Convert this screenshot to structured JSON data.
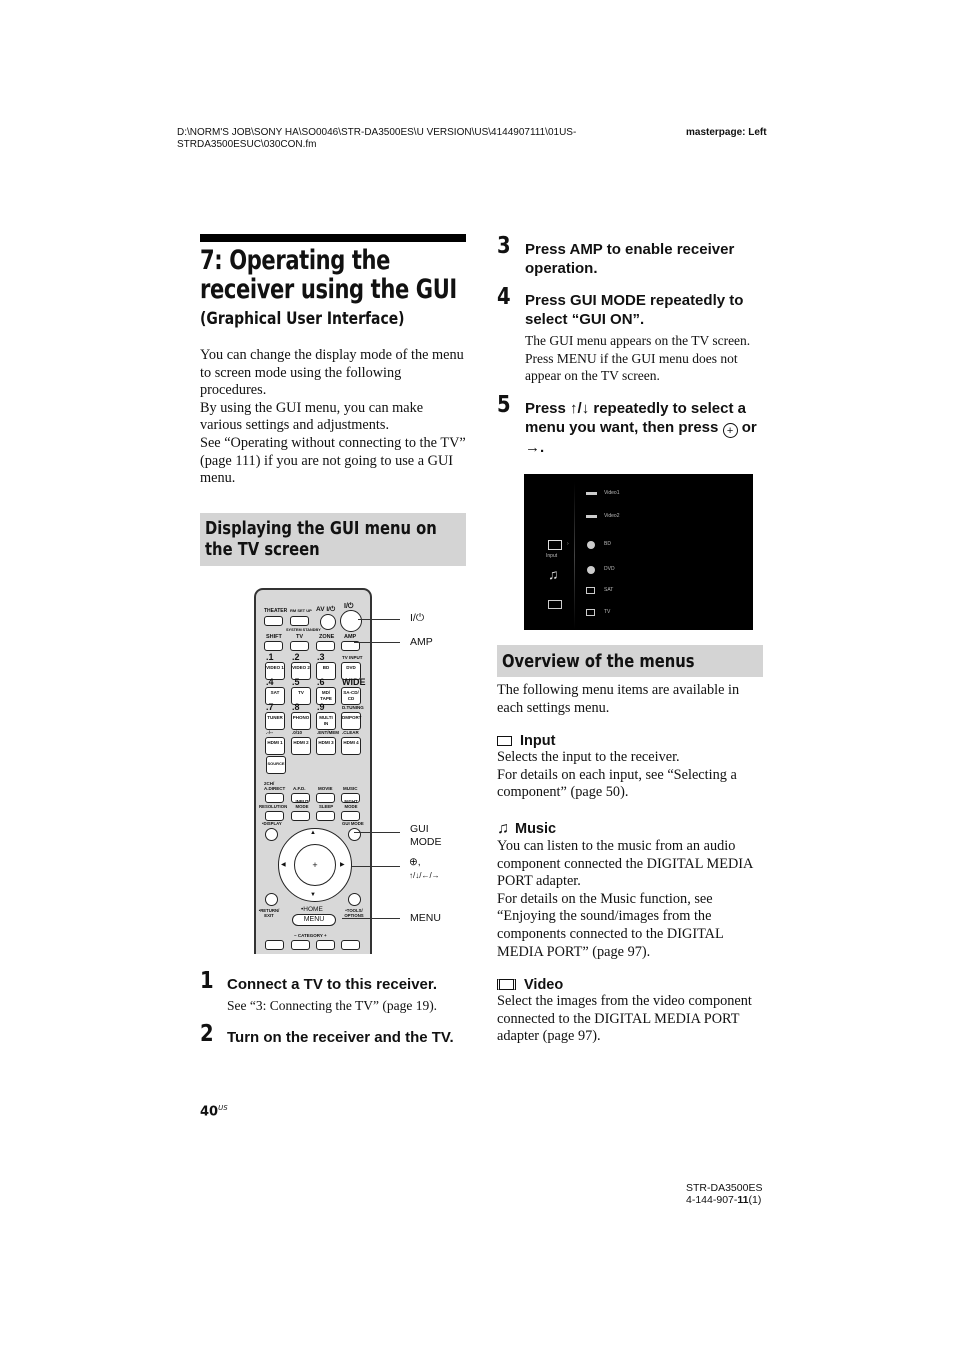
{
  "header": {
    "path_line1": "D:\\NORM'S JOB\\SONY HA\\SO0046\\STR-DA3500ES\\U VERSION\\US\\4144907111\\01US-",
    "path_line2": "STRDA3500ESUC\\030CON.fm",
    "masterpage": "masterpage: Left"
  },
  "title": {
    "main": "7: Operating the receiver using the GUI",
    "subtitle": "(Graphical User Interface)"
  },
  "intro": {
    "p1": "You can change the display mode of the menu to screen mode using the following procedures.",
    "p2": "By using the GUI menu, you can make various settings and adjustments.",
    "p3": "See “Operating without connecting to the TV” (page 111) if you are not going to use a GUI menu."
  },
  "section1": {
    "title": "Displaying the GUI menu on the TV screen"
  },
  "remote": {
    "top_labels": [
      "THEATER",
      "RM SET UP",
      "AV I/⏻",
      "I/⏻"
    ],
    "system_standby": "SYSTEM STANDBY",
    "row2_labels": [
      "SHIFT",
      "TV",
      "ZONE",
      "AMP"
    ],
    "numpad": [
      {
        "num": ".1",
        "key": "VIDEO 1"
      },
      {
        "num": ".2",
        "key": "VIDEO 2"
      },
      {
        "num": ".3",
        "key": "BD"
      },
      {
        "num": "TV INPUT",
        "key": "DVD"
      },
      {
        "num": ".4",
        "key": "SAT"
      },
      {
        "num": ".5",
        "key": "TV"
      },
      {
        "num": ".6",
        "key": "MD/ TAPE"
      },
      {
        "num": "WIDE",
        "key": "SA-CD/ CD"
      },
      {
        "num": ".7",
        "key": "TUNER"
      },
      {
        "num": ".8",
        "key": "PHONO"
      },
      {
        "num": ".9",
        "key": "MULTI IN"
      },
      {
        "num": "D.TUNING",
        "key": "DMPORT"
      },
      {
        "num": ".-/--",
        "key": "HDMI 1"
      },
      {
        "num": ".0/10",
        "key": "HDMI 2"
      },
      {
        "num": ".ENT/MEM",
        "key": "HDMI 3"
      },
      {
        "num": ".CLEAR",
        "key": "HDMI 4"
      }
    ],
    "source": "SOURCE",
    "mode_row1": [
      "2CH/ A.DIRECT",
      "A.F.D.",
      "MOVIE",
      "MUSIC"
    ],
    "mode_row2": [
      "RESOLUTION",
      "INPUT MODE",
      "SLEEP",
      "NIGHT MODE"
    ],
    "display": "•DISPLAY",
    "gui_mode": "GUI MODE",
    "return_exit": "•RETURN/ EXIT",
    "home": "•HOME",
    "menu": "MENU",
    "tools_options": "•TOOLS/ OPTIONS",
    "category": "−  CATEGORY  +"
  },
  "callouts": {
    "power": "I/⏻",
    "amp": "AMP",
    "gui_mode": "GUI MODE",
    "enter_arrows_line1": "⊕,",
    "enter_arrows_line2": "↑/↓/←/→",
    "menu": "MENU"
  },
  "steps": [
    {
      "num": "1",
      "text": "Connect a TV to this receiver.",
      "sub": "See “3: Connecting the TV” (page 19)."
    },
    {
      "num": "2",
      "text": "Turn on the receiver and the TV.",
      "sub": ""
    },
    {
      "num": "3",
      "text": "Press AMP to enable receiver operation.",
      "sub": ""
    },
    {
      "num": "4",
      "text": "Press GUI MODE repeatedly to select “GUI ON”.",
      "sub": "The GUI menu appears on the TV screen. Press MENU if the GUI menu does not appear on the TV screen."
    },
    {
      "num": "5",
      "text_a": "Press ↑/↓ repeatedly to select a menu you want, then press ",
      "text_b": " or →.",
      "sub": ""
    }
  ],
  "gui_screen": {
    "left_menu": [
      {
        "label": "Input",
        "icon": "input-icon"
      },
      {
        "label": "",
        "icon": "music-icon"
      },
      {
        "label": "",
        "icon": "video-icon"
      }
    ],
    "items": [
      "Video1",
      "Video2",
      "BD",
      "DVD",
      "SAT",
      "TV"
    ]
  },
  "section2": {
    "title": "Overview of the menus"
  },
  "overview_intro": "The following menu items are available in each settings menu.",
  "menus": [
    {
      "icon": "input-icon",
      "title": "Input",
      "lines": [
        "Selects the input to the receiver.",
        "For details on each input, see “Selecting a component” (page 50)."
      ]
    },
    {
      "icon": "music-icon",
      "title": "Music",
      "lines": [
        "You can listen to the music from an audio component connected the DIGITAL MEDIA PORT adapter.",
        "For details on the Music function, see “Enjoying the sound/images from the components connected to the DIGITAL MEDIA PORT” (page 97)."
      ]
    },
    {
      "icon": "video-icon",
      "title": "Video",
      "lines": [
        "Select the images from the video component connected to the DIGITAL MEDIA PORT adapter (page 97)."
      ]
    }
  ],
  "footer": {
    "page_num": "40",
    "page_sup": "US",
    "model": "STR-DA3500ES",
    "code_a": "4-144-907-",
    "code_b": "11",
    "code_c": "(1)"
  }
}
